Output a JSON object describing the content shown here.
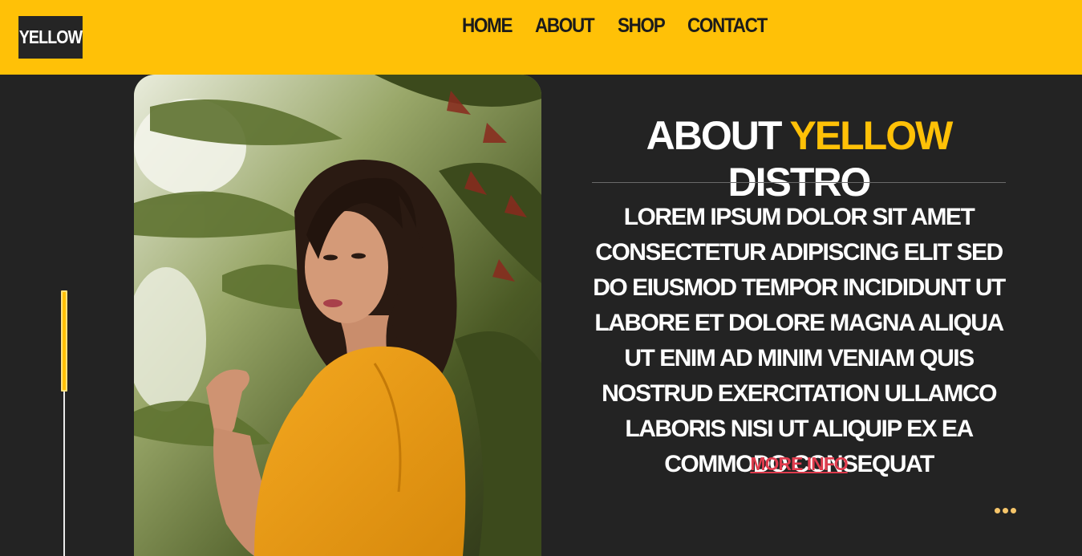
{
  "header": {
    "logo": "YELLOW",
    "nav": [
      {
        "label": "HOME"
      },
      {
        "label": "ABOUT"
      },
      {
        "label": "SHOP"
      },
      {
        "label": "CONTACT"
      }
    ]
  },
  "about": {
    "title_prefix": "ABOUT",
    "title_accent": "YELLOW",
    "title_suffix": "DISTRO",
    "body": "LOREM IPSUM DOLOR SIT AMET CONSECTETUR ADIPISCING ELIT SED DO EIUSMOD TEMPOR INCIDIDUNT UT LABORE ET DOLORE MAGNA ALIQUA UT ENIM AD MINIM VENIAM QUIS NOSTRUD EXERCITATION ULLAMCO LABORIS NISI UT ALIQUIP EX EA COMMODO CONSEQUAT",
    "more_info": "MORE INFO"
  },
  "colors": {
    "brand_yellow": "#ffc107",
    "background": "#232323",
    "link_red": "#e03c4e"
  },
  "icons": {
    "more": "three-dots-icon"
  }
}
